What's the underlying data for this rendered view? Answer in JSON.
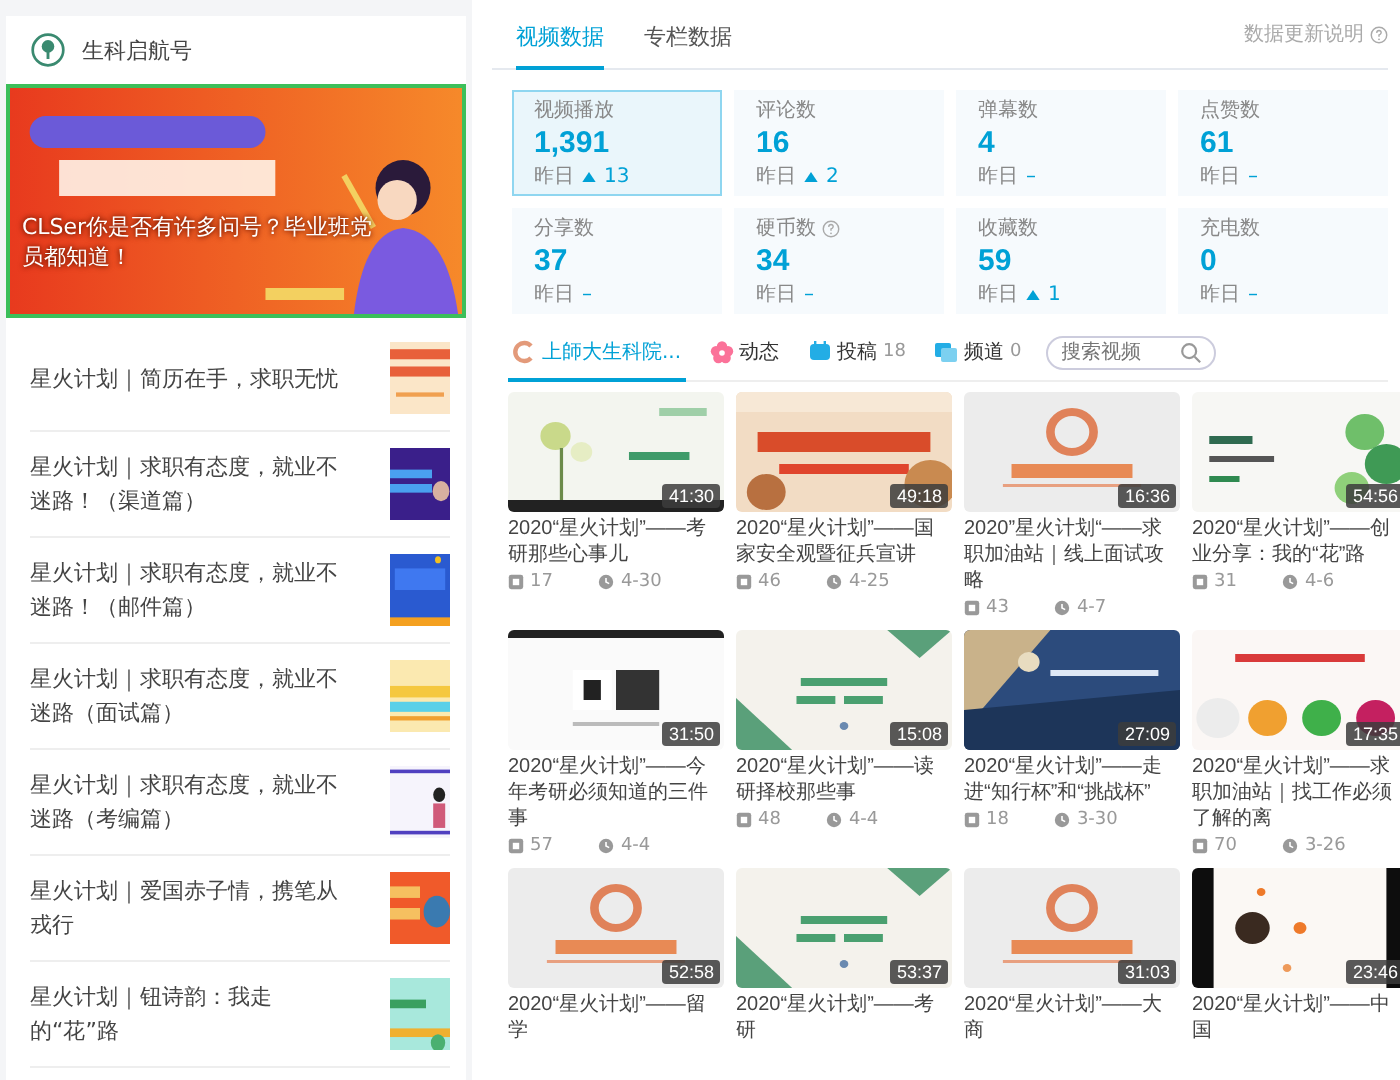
{
  "sidebar": {
    "account": "生科启航号",
    "banner": {
      "caption": "CLSer你是否有许多问号？毕业班党员都知道！"
    },
    "articles": [
      {
        "title": "星火计划｜简历在手，求职无忧"
      },
      {
        "title": "星火计划｜求职有态度，就业不迷路！（渠道篇）"
      },
      {
        "title": "星火计划｜求职有态度，就业不迷路！（邮件篇）"
      },
      {
        "title": "星火计划｜求职有态度，就业不迷路（面试篇）"
      },
      {
        "title": "星火计划｜求职有态度，就业不迷路（考编篇）"
      },
      {
        "title": "星火计划｜爱国赤子情，携笔从戎行"
      },
      {
        "title": "星火计划｜钮诗韵：我走的“花”路"
      }
    ]
  },
  "tabs": [
    {
      "label": "视频数据",
      "selected": true
    },
    {
      "label": "专栏数据",
      "selected": false
    }
  ],
  "update_note": "数据更新说明",
  "stats": [
    {
      "label": "视频播放",
      "value": "1,391",
      "yesterday": "昨日",
      "rising": true,
      "delta": "13",
      "help": false,
      "selected": true
    },
    {
      "label": "评论数",
      "value": "16",
      "yesterday": "昨日",
      "rising": true,
      "delta": "2",
      "help": false,
      "selected": false
    },
    {
      "label": "弹幕数",
      "value": "4",
      "yesterday": "昨日",
      "rising": false,
      "delta": "–",
      "help": false,
      "selected": false
    },
    {
      "label": "点赞数",
      "value": "61",
      "yesterday": "昨日",
      "rising": false,
      "delta": "–",
      "help": false,
      "selected": false
    },
    {
      "label": "分享数",
      "value": "37",
      "yesterday": "昨日",
      "rising": false,
      "delta": "–",
      "help": false,
      "selected": false
    },
    {
      "label": "硬币数",
      "value": "34",
      "yesterday": "昨日",
      "rising": false,
      "delta": "–",
      "help": true,
      "selected": false
    },
    {
      "label": "收藏数",
      "value": "59",
      "yesterday": "昨日",
      "rising": true,
      "delta": "1",
      "help": false,
      "selected": false
    },
    {
      "label": "充电数",
      "value": "0",
      "yesterday": "昨日",
      "rising": false,
      "delta": "–",
      "help": false,
      "selected": false
    }
  ],
  "channel_nav": [
    {
      "kind": "home",
      "label": "上師大生科院...",
      "selected": true
    },
    {
      "kind": "dynamic",
      "label": "动态",
      "selected": false
    },
    {
      "kind": "posts",
      "label": "投稿",
      "count": "18",
      "selected": false
    },
    {
      "kind": "channels",
      "label": "频道",
      "count": "0",
      "selected": false
    }
  ],
  "search": {
    "placeholder": "搜索视频"
  },
  "videos": [
    {
      "title": "2020“星火计划”——考研那些心事儿",
      "duration": "41:30",
      "plays": "17",
      "date": "4-30"
    },
    {
      "title": "2020“星火计划”——国家安全观暨征兵宣讲",
      "duration": "49:18",
      "plays": "46",
      "date": "4-25"
    },
    {
      "title": "2020”星火计划“——求职加油站｜线上面试攻略",
      "duration": "16:36",
      "plays": "43",
      "date": "4-7"
    },
    {
      "title": "2020“星火计划”——创业分享：我的“花”路",
      "duration": "54:56",
      "plays": "31",
      "date": "4-6"
    },
    {
      "title": "2020“星火计划”——今年考研必须知道的三件事",
      "duration": "31:50",
      "plays": "57",
      "date": "4-4"
    },
    {
      "title": "2020“星火计划”——读研择校那些事",
      "duration": "15:08",
      "plays": "48",
      "date": "4-4"
    },
    {
      "title": "2020“星火计划”——走进“知行杯”和“挑战杯”",
      "duration": "27:09",
      "plays": "18",
      "date": "3-30"
    },
    {
      "title": "2020“星火计划”——求职加油站｜找工作必须了解的离",
      "duration": "17:35",
      "plays": "70",
      "date": "3-26"
    },
    {
      "title": "2020“星火计划”——留学",
      "duration": "52:58"
    },
    {
      "title": "2020“星火计划”——考研",
      "duration": "53:37"
    },
    {
      "title": "2020“星火计划”——大商",
      "duration": "31:03"
    },
    {
      "title": "2020“星火计划”——中国",
      "duration": "23:46"
    }
  ]
}
